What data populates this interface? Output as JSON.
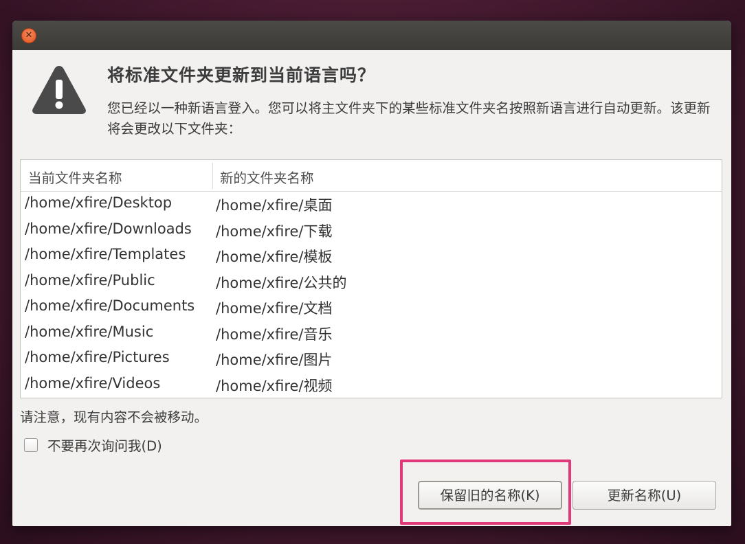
{
  "dialog": {
    "close_icon": "close-icon",
    "warning_icon": "warning-icon",
    "heading": "将标准文件夹更新到当前语言吗？",
    "description": "您已经以一种新语言登入。您可以将主文件夹下的某些标准文件夹名按照新语言进行自动更新。该更新将会更改以下文件夹："
  },
  "table": {
    "headers": [
      "当前文件夹名称",
      "新的文件夹名称"
    ],
    "rows": [
      [
        "/home/xfire/Desktop",
        "/home/xfire/桌面"
      ],
      [
        "/home/xfire/Downloads",
        "/home/xfire/下载"
      ],
      [
        "/home/xfire/Templates",
        "/home/xfire/模板"
      ],
      [
        "/home/xfire/Public",
        "/home/xfire/公共的"
      ],
      [
        "/home/xfire/Documents",
        "/home/xfire/文档"
      ],
      [
        "/home/xfire/Music",
        "/home/xfire/音乐"
      ],
      [
        "/home/xfire/Pictures",
        "/home/xfire/图片"
      ],
      [
        "/home/xfire/Videos",
        "/home/xfire/视频"
      ]
    ]
  },
  "note": "请注意，现有内容不会被移动。",
  "checkbox": {
    "label": "不要再次询问我(D)",
    "checked": false
  },
  "buttons": {
    "keep": "保留旧的名称(K)",
    "update": "更新名称(U)"
  },
  "colors": {
    "highlight": "#e0397a",
    "close_button": "#e4531f",
    "titlebar": "#3c3b37"
  }
}
